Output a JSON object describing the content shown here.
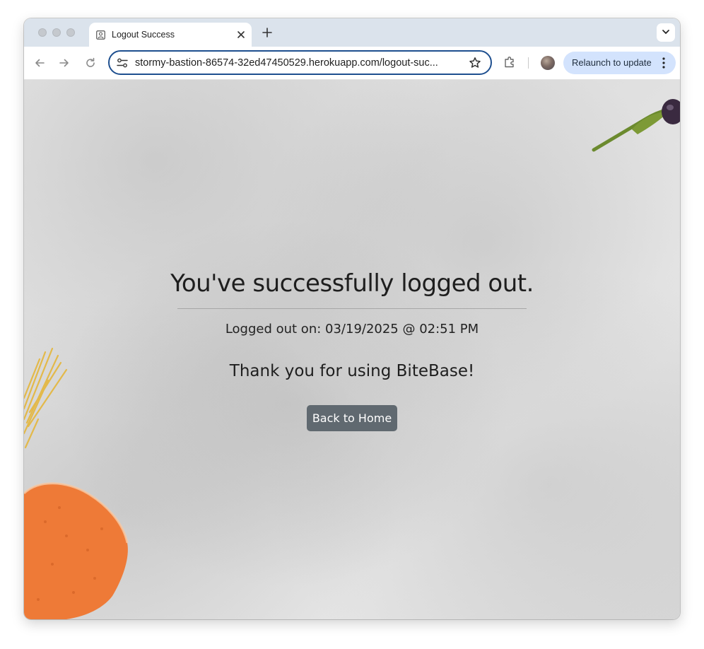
{
  "browser": {
    "tab": {
      "title": "Logout Success",
      "favicon": "page-icon"
    },
    "address_bar": {
      "url": "stormy-bastion-86574-32ed47450529.herokuapp.com/logout-suc..."
    },
    "relaunch_label": "Relaunch to update",
    "accent_color": "#d3e3fd"
  },
  "page": {
    "title": "You've successfully logged out.",
    "logged_out_text": "Logged out on: 03/19/2025 @ 02:51 PM",
    "thanks_text": "Thank you for using BiteBase!",
    "home_button": "Back to Home",
    "button_color": "#606970"
  }
}
